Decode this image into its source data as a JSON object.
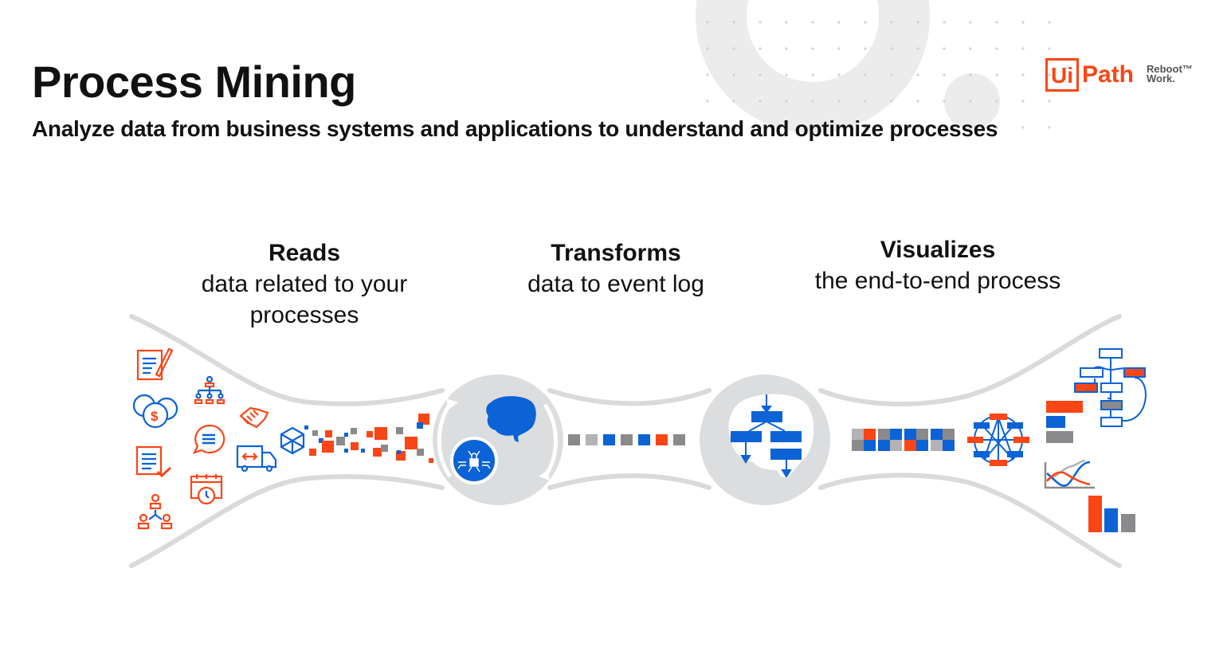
{
  "header": {
    "title": "Process Mining",
    "subtitle": "Analyze data from business systems and applications to understand and optimize processes"
  },
  "logo": {
    "brand_box": "Ui",
    "brand_word": "Path",
    "tagline_line1": "Reboot™",
    "tagline_line2": "Work."
  },
  "stages": [
    {
      "head": "Reads",
      "line1": "data related to your",
      "line2": "processes"
    },
    {
      "head": "Transforms",
      "line1": "data to event log",
      "line2": ""
    },
    {
      "head": "Visualizes",
      "line1": "the end-to-end process",
      "line2": ""
    }
  ],
  "colors": {
    "orange": "#fa4616",
    "blue": "#0b63d6",
    "gray": "#8a8a8c",
    "lightgray": "#b3b3b5",
    "tube": "#d9dadb",
    "bgdot": "#e6e6e6"
  },
  "icons": {
    "source_icons": [
      "document-edit-icon",
      "currency-coins-icon",
      "checklist-icon",
      "team-icon",
      "org-chart-icon",
      "chat-bubble-icon",
      "calendar-clock-icon",
      "handshake-icon",
      "delivery-truck-icon",
      "cube-icon"
    ],
    "transform_icons": [
      "brain-icon",
      "secure-circuit-icon",
      "cycle-arrows-icon"
    ],
    "visual_icons": [
      "brain-flowchart-icon",
      "network-graph-icon",
      "process-map-icon",
      "bar-chart-horizontal-icon",
      "line-chart-icon",
      "bar-chart-vertical-icon"
    ]
  },
  "event_log_squares": [
    "gray",
    "lightgray",
    "blue",
    "gray",
    "blue",
    "orange",
    "gray"
  ],
  "matrix_tiles": [
    [
      "lightgray",
      "orange",
      "gray",
      "blue"
    ],
    [
      "gray",
      "blue",
      "blue",
      "lightgray"
    ],
    [
      "blue",
      "gray",
      "orange",
      "blue"
    ],
    [
      "blue",
      "gray",
      "lightgray",
      "blue"
    ]
  ]
}
